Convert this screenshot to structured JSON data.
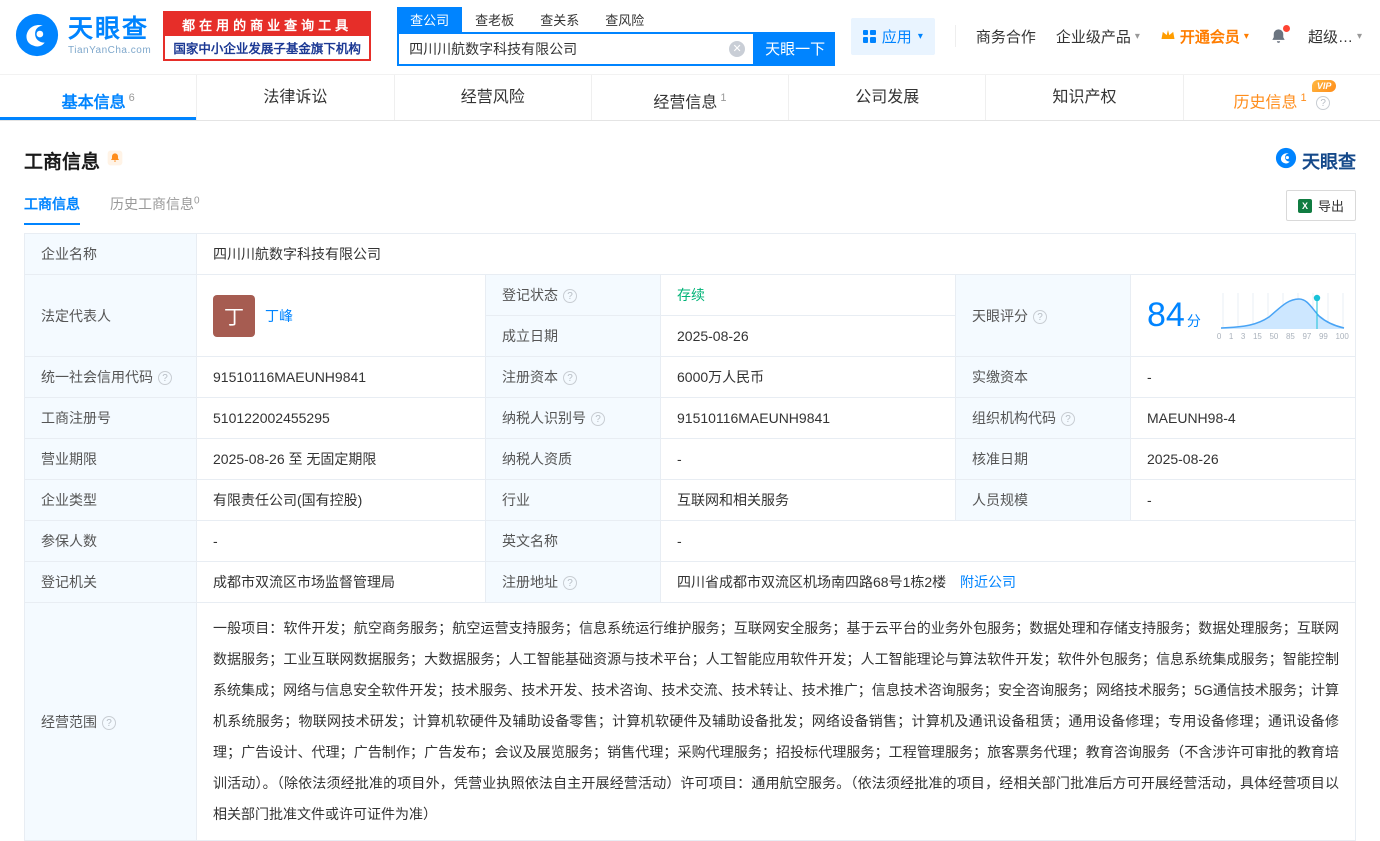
{
  "theme": {
    "brand_blue": "#0084ff",
    "badge_red": "#e62e29",
    "vip_orange": "#ff8c1a",
    "status_green": "#00b377",
    "label_bg": "#f4faff"
  },
  "brand": {
    "name": "天眼查",
    "domain": "TianYanCha.com",
    "slogan1": "都在用的商业查询工具",
    "slogan2": "国家中小企业发展子基金旗下机构"
  },
  "search": {
    "tabs": [
      {
        "label": "查公司"
      },
      {
        "label": "查老板"
      },
      {
        "label": "查关系"
      },
      {
        "label": "查风险"
      }
    ],
    "value": "四川川航数字科技有限公司",
    "button": "天眼一下"
  },
  "topnav": {
    "apps": "应用",
    "cooperation": "商务合作",
    "enterprise": "企业级产品",
    "vip": "开通会员",
    "super": "超级…"
  },
  "tabs": {
    "vip_badge": "VIP",
    "items": [
      {
        "label": "基本信息",
        "count": "6"
      },
      {
        "label": "法律诉讼",
        "count": ""
      },
      {
        "label": "经营风险",
        "count": ""
      },
      {
        "label": "经营信息",
        "count": "1"
      },
      {
        "label": "公司发展",
        "count": ""
      },
      {
        "label": "知识产权",
        "count": ""
      },
      {
        "label": "历史信息",
        "count": "1"
      }
    ]
  },
  "section": {
    "title": "工商信息",
    "logo": "天眼查",
    "subtab_active": "工商信息",
    "subtab_history": {
      "label": "历史工商信息",
      "count": "0"
    },
    "export": "导出"
  },
  "info": {
    "company_name": {
      "label": "企业名称",
      "value": "四川川航数字科技有限公司"
    },
    "legal_rep": {
      "label": "法定代表人",
      "value": "丁峰",
      "avatar": "丁"
    },
    "reg_status": {
      "label": "登记状态",
      "value": "存续"
    },
    "establish_date": {
      "label": "成立日期",
      "value": "2025-08-26"
    },
    "score": {
      "label": "天眼评分",
      "value": "84",
      "unit": "分",
      "ticks": [
        "0",
        "1",
        "3",
        "15",
        "50",
        "85",
        "97",
        "99",
        "100"
      ]
    },
    "credit_code": {
      "label": "统一社会信用代码",
      "value": "91510116MAEUNH9841"
    },
    "reg_capital": {
      "label": "注册资本",
      "value": "6000万人民币"
    },
    "paid_capital": {
      "label": "实缴资本",
      "value": "-"
    },
    "reg_number": {
      "label": "工商注册号",
      "value": "510122002455295"
    },
    "tax_number": {
      "label": "纳税人识别号",
      "value": "91510116MAEUNH9841"
    },
    "org_code": {
      "label": "组织机构代码",
      "value": "MAEUNH98-4"
    },
    "business_term": {
      "label": "营业期限",
      "value": "2025-08-26 至 无固定期限"
    },
    "taxpayer_quality": {
      "label": "纳税人资质",
      "value": "-"
    },
    "approval_date": {
      "label": "核准日期",
      "value": "2025-08-26"
    },
    "company_type": {
      "label": "企业类型",
      "value": "有限责任公司(国有控股)"
    },
    "industry": {
      "label": "行业",
      "value": "互联网和相关服务"
    },
    "staff_size": {
      "label": "人员规模",
      "value": "-"
    },
    "insured_count": {
      "label": "参保人数",
      "value": "-"
    },
    "english_name": {
      "label": "英文名称",
      "value": "-"
    },
    "reg_authority": {
      "label": "登记机关",
      "value": "成都市双流区市场监督管理局"
    },
    "reg_address": {
      "label": "注册地址",
      "value": "四川省成都市双流区机场南四路68号1栋2楼",
      "link": "附近公司"
    },
    "business_scope": {
      "label": "经营范围",
      "value": "一般项目：软件开发；航空商务服务；航空运营支持服务；信息系统运行维护服务；互联网安全服务；基于云平台的业务外包服务；数据处理和存储支持服务；数据处理服务；互联网数据服务；工业互联网数据服务；大数据服务；人工智能基础资源与技术平台；人工智能应用软件开发；人工智能理论与算法软件开发；软件外包服务；信息系统集成服务；智能控制系统集成；网络与信息安全软件开发；技术服务、技术开发、技术咨询、技术交流、技术转让、技术推广；信息技术咨询服务；安全咨询服务；网络技术服务；5G通信技术服务；计算机系统服务；物联网技术研发；计算机软硬件及辅助设备零售；计算机软硬件及辅助设备批发；网络设备销售；计算机及通讯设备租赁；通用设备修理；专用设备修理；通讯设备修理；广告设计、代理；广告制作；广告发布；会议及展览服务；销售代理；采购代理服务；招投标代理服务；工程管理服务；旅客票务代理；教育咨询服务（不含涉许可审批的教育培训活动）。（除依法须经批准的项目外，凭营业执照依法自主开展经营活动）许可项目：通用航空服务。（依法须经批准的项目，经相关部门批准后方可开展经营活动，具体经营项目以相关部门批准文件或许可证件为准）"
    }
  }
}
